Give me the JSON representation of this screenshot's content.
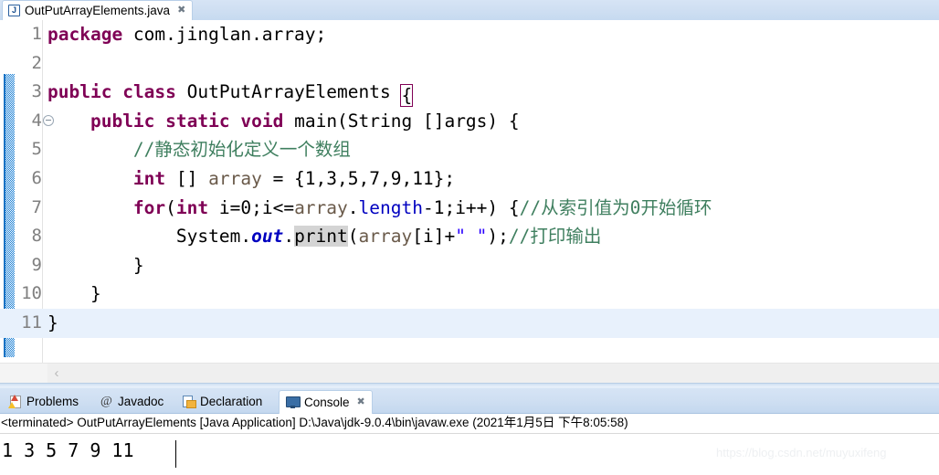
{
  "editor": {
    "tab": {
      "icon": "java-file-icon",
      "icon_letter": "J",
      "label": "OutPutArrayElements.java",
      "close": "✖"
    },
    "lines": [
      {
        "num": "1",
        "text": "package com.jinglan.array;"
      },
      {
        "num": "2",
        "text": ""
      },
      {
        "num": "3",
        "text": "public class OutPutArrayElements {"
      },
      {
        "num": "4",
        "text": "    public static void main(String []args) {"
      },
      {
        "num": "5",
        "text": "        //静态初始化定义一个数组"
      },
      {
        "num": "6",
        "text": "        int [] array = {1,3,5,7,9,11};"
      },
      {
        "num": "7",
        "text": "        for(int i=0;i<=array.length-1;i++) {//从索引值为0开始循环"
      },
      {
        "num": "8",
        "text": "            System.out.print(array[i]+\" \");//打印输出"
      },
      {
        "num": "9",
        "text": "        }"
      },
      {
        "num": "10",
        "text": "    }"
      },
      {
        "num": "11",
        "text": "}"
      }
    ],
    "tokens": {
      "kw_package": "package",
      "pkg_name": " com.jinglan.array;",
      "kw_public": "public",
      "kw_class": "class",
      "class_name": "OutPutArrayElements",
      "brace_open": "{",
      "kw_static": "static",
      "kw_void": "void",
      "main_sig": "main(String []args) {",
      "comment_static_init": "//静态初始化定义一个数组",
      "kw_int": "int",
      "arr_decl": " [] ",
      "var_array": "array",
      "arr_init": " = {1,3,5,7,9,11};",
      "kw_for": "for",
      "for_open": "(",
      "for_i": " i=0;i<=",
      "dot": ".",
      "field_length": "length",
      "for_tail": "-1;i++) {",
      "comment_loop": "//从索引值为0开始循环",
      "system": "System.",
      "out": "out",
      "print": "print",
      "print_args_a": "(",
      "print_args_b": "[i]+",
      "space_string": "\" \"",
      "print_end": ");",
      "comment_print": "//打印输出",
      "close_inner": "}",
      "close_method": "}",
      "close_class": "}"
    },
    "fold_marker_line": "4",
    "highlight_line": "11",
    "scroll_left_arrow": "‹"
  },
  "bottom_view": {
    "tabs": [
      {
        "label": "Problems",
        "icon": "problems-icon",
        "active": false
      },
      {
        "label": "Javadoc",
        "icon": "at-icon",
        "active": false
      },
      {
        "label": "Declaration",
        "icon": "declaration-icon",
        "active": false
      },
      {
        "label": "Console",
        "icon": "console-icon",
        "active": true
      }
    ],
    "close": "✖",
    "console_header": "<terminated> OutPutArrayElements [Java Application] D:\\Java\\jdk-9.0.4\\bin\\javaw.exe (2021年1月5日 下午8:05:58)",
    "console_output": "1 3 5 7 9 11"
  },
  "watermark": "https://blog.csdn.net/muyuxifeng",
  "colors": {
    "keyword": "#7f0055",
    "comment": "#3f7f5f",
    "string": "#2a00ff",
    "field": "#0000c0",
    "local_var": "#6a5a4a",
    "selection": "#d4d4d4",
    "current_line": "#e8f1fc",
    "change_bar": "#1872c4",
    "tab_gradient": "#cfdff2"
  }
}
